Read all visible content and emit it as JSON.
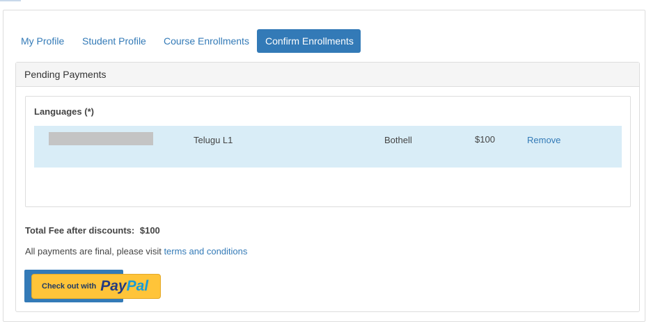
{
  "tabs": [
    {
      "label": "My Profile"
    },
    {
      "label": "Student Profile"
    },
    {
      "label": "Course Enrollments"
    },
    {
      "label": "Confirm Enrollments",
      "active": true
    }
  ],
  "panel": {
    "heading": "Pending Payments",
    "section_title": "Languages (*)",
    "enrollment": {
      "student_name": "",
      "course": "Telugu L1",
      "location": "Bothell",
      "price": "$100",
      "remove_label": "Remove"
    },
    "total": {
      "label": "Total Fee after discounts:",
      "amount": "$100"
    },
    "notice": {
      "text": "All payments are final, please visit ",
      "link_label": "terms and conditions"
    },
    "checkout": {
      "prefix": "Check out with",
      "logo_pay": "Pay",
      "logo_pal": "Pal"
    }
  },
  "colors": {
    "accent": "#337ab7",
    "row_highlight": "#d9edf7",
    "paypal_yellow": "#ffc439"
  }
}
